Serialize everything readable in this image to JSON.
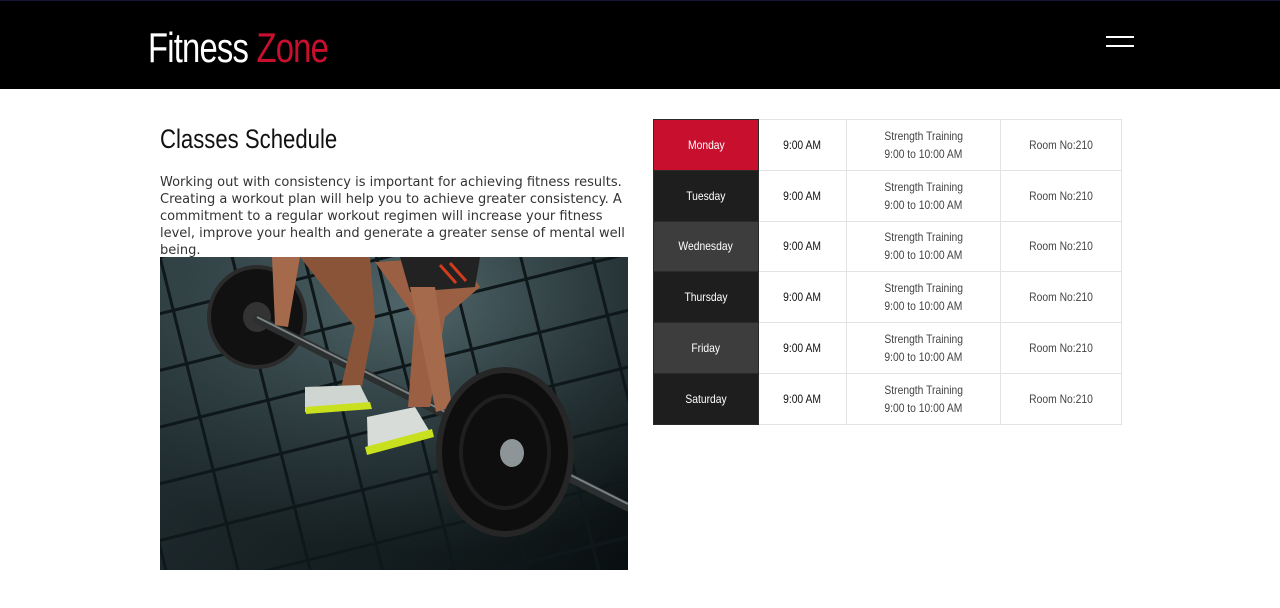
{
  "header": {
    "brand_first": "Fitness",
    "brand_second": "Zone",
    "menu_icon": "hamburger-menu-icon"
  },
  "main": {
    "title": "Classes Schedule",
    "intro": "Working out with consistency is important for achieving fitness results. Creating a workout plan will help you to achieve greater consistency. A commitment to a regular workout regimen will increase your fitness level, improve your health and generate a greater sense of mental well being."
  },
  "photo": {
    "subject": "athlete lifting barbell image"
  },
  "schedule": {
    "rows": [
      {
        "day": "Monday",
        "time": "9:00 AM",
        "class_name": "Strength Training",
        "class_time": "9:00 to 10:00 AM",
        "room": "Room No:210",
        "color": "#c8102e"
      },
      {
        "day": "Tuesday",
        "time": "9:00 AM",
        "class_name": "Strength Training",
        "class_time": "9:00 to 10:00 AM",
        "room": "Room No:210",
        "color": "#1e1e1e"
      },
      {
        "day": "Wednesday",
        "time": "9:00 AM",
        "class_name": "Strength Training",
        "class_time": "9:00 to 10:00 AM",
        "room": "Room No:210",
        "color": "#3d3d3d"
      },
      {
        "day": "Thursday",
        "time": "9:00 AM",
        "class_name": "Strength Training",
        "class_time": "9:00 to 10:00 AM",
        "room": "Room No:210",
        "color": "#1e1e1e"
      },
      {
        "day": "Friday",
        "time": "9:00 AM",
        "class_name": "Strength Training",
        "class_time": "9:00 to 10:00 AM",
        "room": "Room No:210",
        "color": "#3d3d3d"
      },
      {
        "day": "Saturday",
        "time": "9:00 AM",
        "class_name": "Strength Training",
        "class_time": "9:00 to 10:00 AM",
        "room": "Room No:210",
        "color": "#1e1e1e"
      }
    ]
  },
  "colors": {
    "accent": "#c8102e",
    "header_bg": "#000000"
  }
}
